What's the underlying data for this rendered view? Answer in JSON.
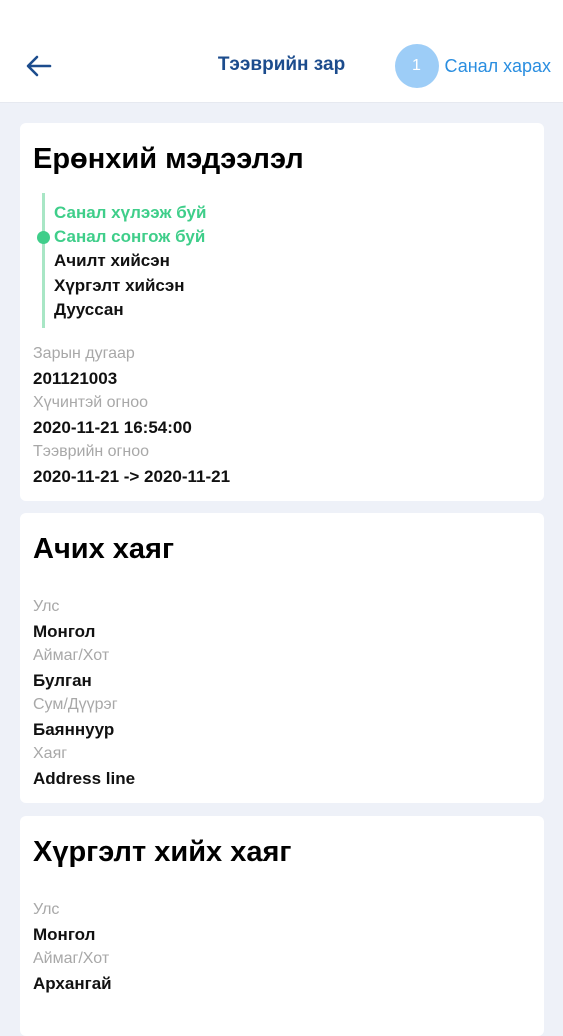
{
  "header": {
    "title": "Тээврийн зар",
    "offers_count": "1",
    "offers_label": "Санал харах"
  },
  "general": {
    "title": "Ерөнхий мэдээлэл",
    "statuses": [
      {
        "label": "Санал хүлээж буй",
        "state": "done"
      },
      {
        "label": "Санал сонгож буй",
        "state": "current"
      },
      {
        "label": "Ачилт хийсэн",
        "state": "pending"
      },
      {
        "label": "Хүргэлт хийсэн",
        "state": "pending"
      },
      {
        "label": "Дууссан",
        "state": "pending"
      }
    ],
    "fields": [
      {
        "label": "Зарын дугаар",
        "value": "201121003"
      },
      {
        "label": "Хүчинтэй огноо",
        "value": "2020-11-21 16:54:00"
      },
      {
        "label": "Тээврийн огноо",
        "value": "2020-11-21 -> 2020-11-21"
      }
    ]
  },
  "pickup": {
    "title": "Ачих хаяг",
    "fields": [
      {
        "label": "Улс",
        "value": "Монгол"
      },
      {
        "label": "Аймаг/Хот",
        "value": "Булган"
      },
      {
        "label": "Сум/Дүүрэг",
        "value": "Баяннуур"
      },
      {
        "label": "Хаяг",
        "value": "Address line"
      }
    ]
  },
  "delivery": {
    "title": "Хүргэлт хийх хаяг",
    "fields": [
      {
        "label": "Улс",
        "value": "Монгол"
      },
      {
        "label": "Аймаг/Хот",
        "value": "Архангай"
      }
    ]
  },
  "colors": {
    "accent": "#1c4c8d",
    "link": "#2a8ee0",
    "badge": "#9dcdf7",
    "status_done": "#3fce8a"
  }
}
